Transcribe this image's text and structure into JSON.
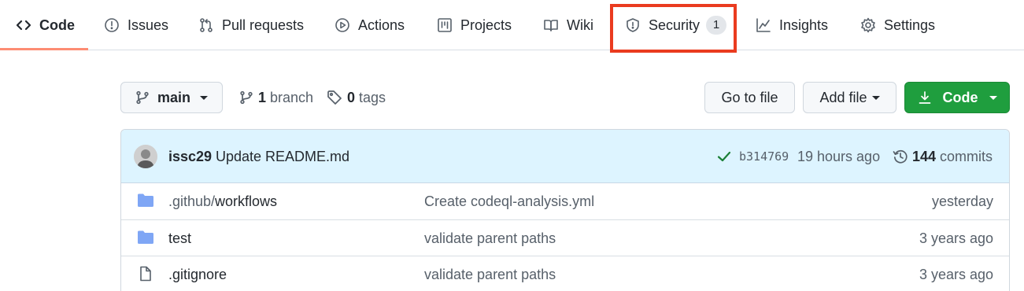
{
  "tabs": [
    {
      "label": "Code",
      "icon": "code-icon",
      "active": true
    },
    {
      "label": "Issues",
      "icon": "issue-opened-icon"
    },
    {
      "label": "Pull requests",
      "icon": "git-pull-request-icon"
    },
    {
      "label": "Actions",
      "icon": "play-icon"
    },
    {
      "label": "Projects",
      "icon": "project-icon"
    },
    {
      "label": "Wiki",
      "icon": "book-icon"
    },
    {
      "label": "Security",
      "icon": "shield-icon",
      "counter": "1",
      "highlighted": true
    },
    {
      "label": "Insights",
      "icon": "graph-icon"
    },
    {
      "label": "Settings",
      "icon": "gear-icon"
    }
  ],
  "highlight_color": "#ea3b1f",
  "toolbar": {
    "branch_select": "main",
    "branch_count": "1",
    "branch_label": "branch",
    "tag_count": "0",
    "tag_label": "tags",
    "go_to_file": "Go to file",
    "add_file": "Add file",
    "code_button": "Code",
    "code_button_color": "#1f9e3e"
  },
  "latest_commit": {
    "author": "issc29",
    "message": "Update README.md",
    "status": "check-icon",
    "status_color": "#1a7f37",
    "sha": "b314769",
    "time": "19 hours ago",
    "commit_count": "144",
    "commits_label": "commits",
    "bar_color": "#ddf4ff"
  },
  "files": [
    {
      "type": "folder",
      "name_prefix": ".github/",
      "name": "workflows",
      "message": "Create codeql-analysis.yml",
      "date": "yesterday"
    },
    {
      "type": "folder",
      "name_prefix": "",
      "name": "test",
      "message": "validate parent paths",
      "date": "3 years ago"
    },
    {
      "type": "file",
      "name_prefix": "",
      "name": ".gitignore",
      "message": "validate parent paths",
      "date": "3 years ago"
    }
  ]
}
